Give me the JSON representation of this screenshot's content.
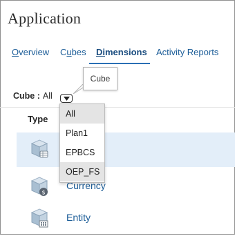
{
  "app": {
    "title": "Application"
  },
  "tabs": [
    {
      "pre": "",
      "ul": "O",
      "post": "verview",
      "active": false
    },
    {
      "pre": "C",
      "ul": "u",
      "post": "bes",
      "active": false
    },
    {
      "pre": "",
      "ul": "Di",
      "post": "mensions",
      "active": true
    },
    {
      "pre": "",
      "ul": "",
      "post": "Activity Reports",
      "active": false
    }
  ],
  "tooltip": {
    "text": "Cube"
  },
  "filter": {
    "label": "Cube :",
    "value": "All"
  },
  "table": {
    "type_header": "Type"
  },
  "rows": [
    {
      "name": "",
      "icon": "dimension-table-icon",
      "selected": true
    },
    {
      "name": "Currency",
      "icon": "dimension-currency-icon",
      "selected": false
    },
    {
      "name": "Entity",
      "icon": "dimension-entity-icon",
      "selected": false
    }
  ],
  "dropdown": {
    "options": [
      "All",
      "Plan1",
      "EPBCS",
      "OEP_FS"
    ],
    "highlighted": [
      "All",
      "OEP_FS"
    ]
  },
  "colors": {
    "link": "#1c5d98",
    "tab_underline": "#2a6fb4",
    "row_selected": "#e3eef9"
  }
}
